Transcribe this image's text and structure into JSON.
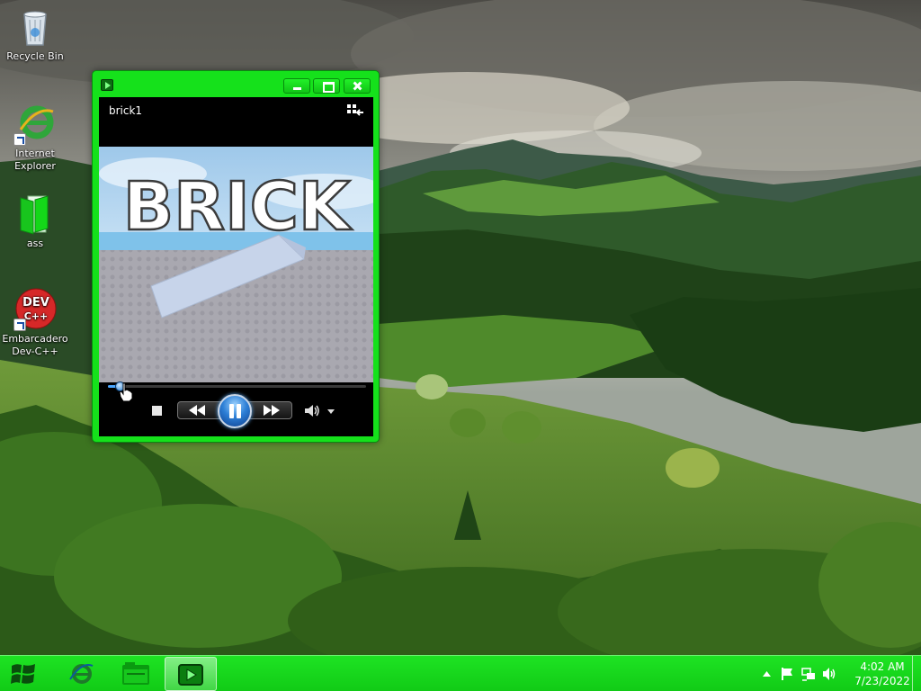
{
  "desktop": {
    "icons": [
      {
        "label": "Recycle Bin",
        "icon": "recycle-bin-icon"
      },
      {
        "label": "Internet Explorer",
        "icon": "internet-explorer-icon"
      },
      {
        "label": "ass",
        "icon": "folder-icon"
      },
      {
        "label": "Embarcadero Dev-C++",
        "icon": "dev-cpp-icon",
        "badge_text": "DEV C++"
      }
    ]
  },
  "player": {
    "title": "brick1",
    "video_text": "BRICK",
    "progress": 0.05,
    "state": "playing",
    "accent": "#15e11b"
  },
  "taskbar": {
    "color": "#14d119",
    "items": [
      "start-button",
      "internet-explorer",
      "windows-explorer",
      "windows-media-player"
    ],
    "clock": {
      "time": "4:02 AM",
      "date": "7/23/2022"
    }
  }
}
